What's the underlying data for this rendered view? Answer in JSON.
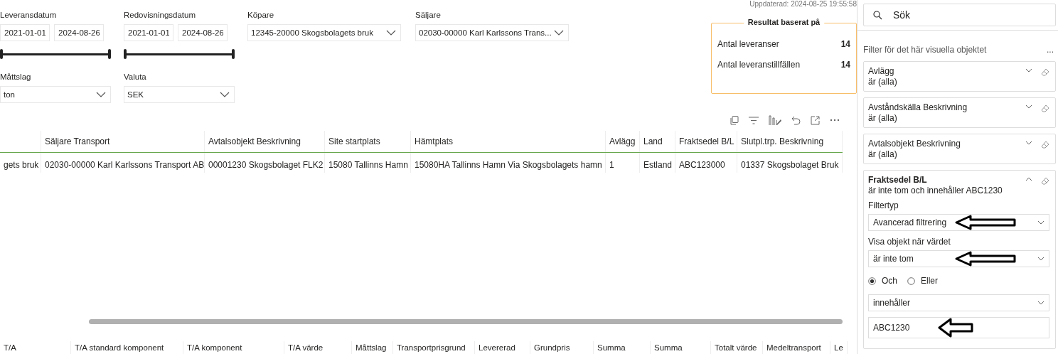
{
  "updated": "Uppdaterad: 2024-08-25 19:55:58",
  "slicers_row1": [
    {
      "kind": "daterange",
      "label": "Leveransdatum",
      "from": "2021-01-01",
      "to": "2024-08-26",
      "level": 1
    },
    {
      "kind": "daterange",
      "label": "Redovisningsdatum",
      "from": "2021-01-01",
      "to": "2024-08-26",
      "level": 1
    },
    {
      "kind": "dropdown",
      "label": "Köpare",
      "value": "12345-20000 Skogsbolagets bruk"
    },
    {
      "kind": "dropdown",
      "label": "Säljare",
      "value": "02030-00000 Karl Karlssons Trans..."
    }
  ],
  "slicers_row2": [
    {
      "kind": "dropdown",
      "label": "Måttslag",
      "value": "ton"
    },
    {
      "kind": "dropdown",
      "label": "Valuta",
      "value": "SEK"
    }
  ],
  "result_card": {
    "title": "Resultat baserat på",
    "rows": [
      {
        "label": "Antal leveranser",
        "value": "14"
      },
      {
        "label": "Antal leveranstillfällen",
        "value": "14"
      }
    ]
  },
  "table": {
    "columns": [
      "",
      "Säljare Transport",
      "Avtalsobjekt Beskrivning",
      "Site startplats",
      "Hämtplats",
      "Avlägg",
      "Land",
      "Fraktsedel B/L",
      "Slutpl.trp. Beskrivning"
    ],
    "rows": [
      [
        "gets bruk",
        "02030-00000 Karl Karlssons Transport AB",
        "00001230 Skogsbolaget FLK2",
        "15080 Tallinns Hamn",
        "15080HA Tallinns Hamn Via Skogsbolagets hamn",
        "1",
        "Estland",
        "ABC123000",
        "01337 Skogsbolaget Bruk"
      ]
    ]
  },
  "table2": {
    "columns": [
      "T/A",
      "T/A standard komponent",
      "T/A komponent",
      "T/A värde",
      "Måttslag",
      "Transportprisgrund",
      "Levererad",
      "Grundpris",
      "Summa",
      "Summa",
      "Totalt värde",
      "Medeltransport",
      "Le"
    ]
  },
  "filter_pane": {
    "search": {
      "placeholder": "Sök"
    },
    "section_title": "Filter för det här visuella objektet",
    "more": "...",
    "cards": [
      {
        "title": "Avlägg",
        "summary": "är (alla)",
        "expanded": false
      },
      {
        "title": "Avståndskälla Beskrivning",
        "summary": "är (alla)",
        "expanded": false
      },
      {
        "title": "Avtalsobjekt Beskrivning",
        "summary": "är (alla)",
        "expanded": false
      },
      {
        "title": "Fraktsedel B/L",
        "summary": "är inte tom och innehåller ABC1230",
        "expanded": true,
        "filter_type_label": "Filtertyp",
        "filter_type": "Avancerad filtrering",
        "show_label": "Visa objekt när värdet",
        "condition1": "är inte tom",
        "logic": [
          {
            "label": "Och",
            "selected": true
          },
          {
            "label": "Eller",
            "selected": false
          }
        ],
        "condition2": "innehåller",
        "value2": "ABC1230"
      }
    ]
  }
}
